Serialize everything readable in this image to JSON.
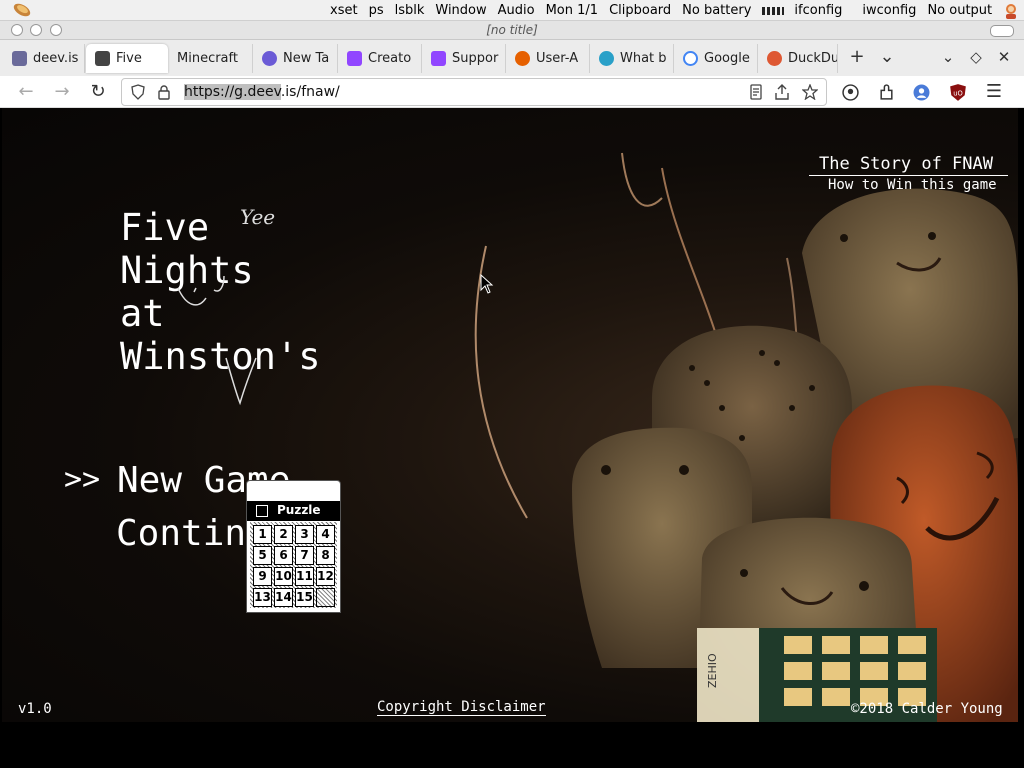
{
  "sysbar": {
    "items": [
      "xset",
      "ps",
      "lsblk",
      "Window",
      "Audio",
      "Mon 1/1",
      "Clipboard",
      "No battery"
    ],
    "ifconfig": "ifconfig",
    "iwconfig": "iwconfig",
    "output": "No output",
    "icons": [
      "bread-logo-icon",
      "bars-icon",
      "user-icon",
      "volume-icon"
    ]
  },
  "window": {
    "title": "[no title]"
  },
  "tabs": [
    {
      "label": "deev.is",
      "favicon_color": "#6a6a9a",
      "active": false
    },
    {
      "label": "Five",
      "favicon_color": "#444444",
      "active": true
    },
    {
      "label": "Minecraft",
      "favicon_color": null,
      "active": false
    },
    {
      "label": "New Ta",
      "favicon_color": "#6b5bd6",
      "active": false
    },
    {
      "label": "Creato",
      "favicon_color": "#9146ff",
      "active": false
    },
    {
      "label": "Suppor",
      "favicon_color": "#9146ff",
      "active": false
    },
    {
      "label": "User-A",
      "favicon_color": "#e66000",
      "active": false
    },
    {
      "label": "What b",
      "favicon_color": "#2aa0c8",
      "active": false
    },
    {
      "label": "Google",
      "favicon_color": "#4285f4",
      "active": false
    },
    {
      "label": "DuckDu",
      "favicon_color": "#de5833",
      "active": false
    }
  ],
  "tab_controls": {
    "new_tab": "+",
    "list": "⌄",
    "win1": "⌄",
    "win2": "◇",
    "close": "✕"
  },
  "nav": {
    "url_selected": "https://g.deev",
    "url_rest": ".is/fnaw/"
  },
  "game": {
    "title_lines": "Five\nNights\nat\nWinston's",
    "scribble": "Yee",
    "menu_arrow": ">>",
    "menu_items": [
      "New Game",
      "Continue"
    ],
    "story_link": "The Story of FNAW",
    "howto_link": "How to Win this game",
    "version": "v1.0",
    "copyright": "Copyright Disclaimer",
    "credit": "©2018 Calder Young"
  },
  "puzzle": {
    "title": "Puzzle",
    "tiles": [
      "1",
      "2",
      "3",
      "4",
      "5",
      "6",
      "7",
      "8",
      "9",
      "10",
      "11",
      "12",
      "13",
      "14",
      "15",
      ""
    ]
  }
}
